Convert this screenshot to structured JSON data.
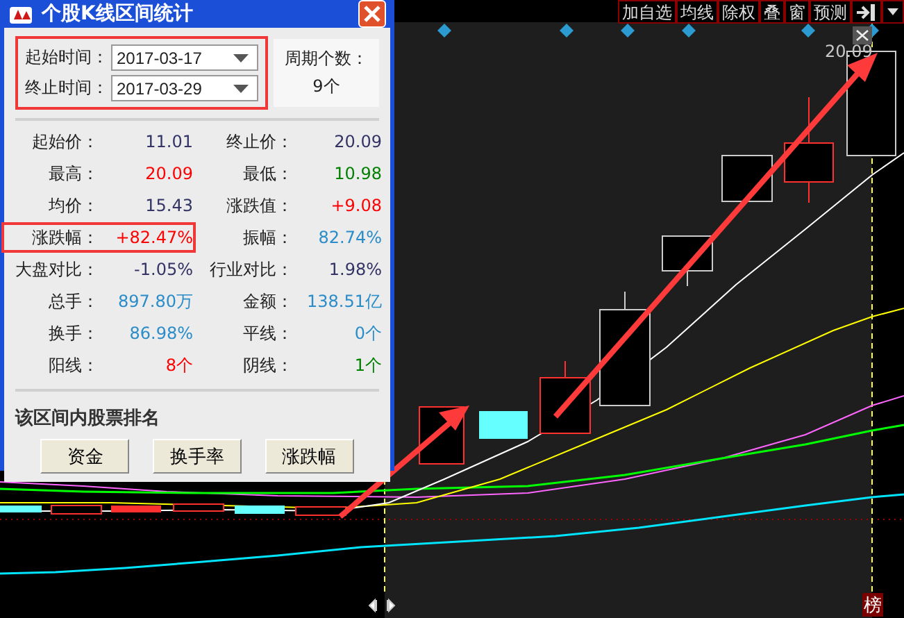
{
  "toolbar": {
    "buttons": [
      "加自选",
      "均线",
      "除权",
      "叠",
      "窗",
      "预测"
    ]
  },
  "chart": {
    "price_label": "20.09",
    "badge": "榜"
  },
  "dialog": {
    "title": "个股K线区间统计",
    "dates": {
      "highlighted": true,
      "fields": [
        {
          "label": "起始时间：",
          "value": "2017-03-17"
        },
        {
          "label": "终止时间：",
          "value": "2017-03-29"
        }
      ]
    },
    "period": {
      "label": "周期个数：",
      "value": "9个"
    },
    "stats": [
      {
        "label": "起始价：",
        "value": "11.01",
        "color": "#333366",
        "highlighted": false
      },
      {
        "label": "终止价：",
        "value": "20.09",
        "color": "#333366",
        "highlighted": false
      },
      {
        "label": "最高：",
        "value": "20.09",
        "color": "#ff0000",
        "highlighted": false
      },
      {
        "label": "最低：",
        "value": "10.98",
        "color": "#008000",
        "highlighted": false
      },
      {
        "label": "均价：",
        "value": "15.43",
        "color": "#333366",
        "highlighted": false
      },
      {
        "label": "涨跌值：",
        "value": "+9.08",
        "color": "#ff0000",
        "highlighted": false
      },
      {
        "label": "涨跌幅：",
        "value": "+82.47%",
        "color": "#ff0000",
        "highlighted": true
      },
      {
        "label": "振幅：",
        "value": "82.74%",
        "color": "#2a8cc8",
        "highlighted": false
      },
      {
        "label": "大盘对比：",
        "value": "-1.05%",
        "color": "#333366",
        "highlighted": false
      },
      {
        "label": "行业对比：",
        "value": "1.98%",
        "color": "#333366",
        "highlighted": false
      },
      {
        "label": "总手：",
        "value": "897.80万",
        "color": "#2a8cc8",
        "highlighted": false
      },
      {
        "label": "金额：",
        "value": "138.51亿",
        "color": "#2a8cc8",
        "highlighted": false
      },
      {
        "label": "换手：",
        "value": "86.98%",
        "color": "#2a8cc8",
        "highlighted": false
      },
      {
        "label": "平线：",
        "value": "0个",
        "color": "#2a8cc8",
        "highlighted": false
      },
      {
        "label": "阳线：",
        "value": "8个",
        "color": "#ff0000",
        "highlighted": false
      },
      {
        "label": "阴线：",
        "value": "1个",
        "color": "#008000",
        "highlighted": false
      }
    ],
    "ranking": {
      "title": "该区间内股票排名",
      "buttons": [
        "资金",
        "换手率",
        "涨跌幅"
      ]
    }
  }
}
